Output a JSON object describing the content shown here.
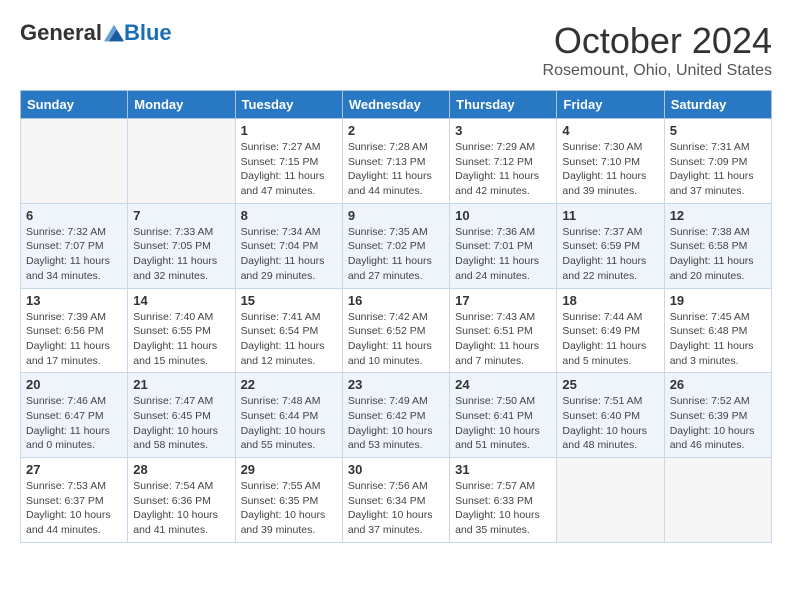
{
  "logo": {
    "general": "General",
    "blue": "Blue"
  },
  "title": "October 2024",
  "location": "Rosemount, Ohio, United States",
  "days_of_week": [
    "Sunday",
    "Monday",
    "Tuesday",
    "Wednesday",
    "Thursday",
    "Friday",
    "Saturday"
  ],
  "weeks": [
    [
      {
        "day": "",
        "info": ""
      },
      {
        "day": "",
        "info": ""
      },
      {
        "day": "1",
        "info": "Sunrise: 7:27 AM\nSunset: 7:15 PM\nDaylight: 11 hours and 47 minutes."
      },
      {
        "day": "2",
        "info": "Sunrise: 7:28 AM\nSunset: 7:13 PM\nDaylight: 11 hours and 44 minutes."
      },
      {
        "day": "3",
        "info": "Sunrise: 7:29 AM\nSunset: 7:12 PM\nDaylight: 11 hours and 42 minutes."
      },
      {
        "day": "4",
        "info": "Sunrise: 7:30 AM\nSunset: 7:10 PM\nDaylight: 11 hours and 39 minutes."
      },
      {
        "day": "5",
        "info": "Sunrise: 7:31 AM\nSunset: 7:09 PM\nDaylight: 11 hours and 37 minutes."
      }
    ],
    [
      {
        "day": "6",
        "info": "Sunrise: 7:32 AM\nSunset: 7:07 PM\nDaylight: 11 hours and 34 minutes."
      },
      {
        "day": "7",
        "info": "Sunrise: 7:33 AM\nSunset: 7:05 PM\nDaylight: 11 hours and 32 minutes."
      },
      {
        "day": "8",
        "info": "Sunrise: 7:34 AM\nSunset: 7:04 PM\nDaylight: 11 hours and 29 minutes."
      },
      {
        "day": "9",
        "info": "Sunrise: 7:35 AM\nSunset: 7:02 PM\nDaylight: 11 hours and 27 minutes."
      },
      {
        "day": "10",
        "info": "Sunrise: 7:36 AM\nSunset: 7:01 PM\nDaylight: 11 hours and 24 minutes."
      },
      {
        "day": "11",
        "info": "Sunrise: 7:37 AM\nSunset: 6:59 PM\nDaylight: 11 hours and 22 minutes."
      },
      {
        "day": "12",
        "info": "Sunrise: 7:38 AM\nSunset: 6:58 PM\nDaylight: 11 hours and 20 minutes."
      }
    ],
    [
      {
        "day": "13",
        "info": "Sunrise: 7:39 AM\nSunset: 6:56 PM\nDaylight: 11 hours and 17 minutes."
      },
      {
        "day": "14",
        "info": "Sunrise: 7:40 AM\nSunset: 6:55 PM\nDaylight: 11 hours and 15 minutes."
      },
      {
        "day": "15",
        "info": "Sunrise: 7:41 AM\nSunset: 6:54 PM\nDaylight: 11 hours and 12 minutes."
      },
      {
        "day": "16",
        "info": "Sunrise: 7:42 AM\nSunset: 6:52 PM\nDaylight: 11 hours and 10 minutes."
      },
      {
        "day": "17",
        "info": "Sunrise: 7:43 AM\nSunset: 6:51 PM\nDaylight: 11 hours and 7 minutes."
      },
      {
        "day": "18",
        "info": "Sunrise: 7:44 AM\nSunset: 6:49 PM\nDaylight: 11 hours and 5 minutes."
      },
      {
        "day": "19",
        "info": "Sunrise: 7:45 AM\nSunset: 6:48 PM\nDaylight: 11 hours and 3 minutes."
      }
    ],
    [
      {
        "day": "20",
        "info": "Sunrise: 7:46 AM\nSunset: 6:47 PM\nDaylight: 11 hours and 0 minutes."
      },
      {
        "day": "21",
        "info": "Sunrise: 7:47 AM\nSunset: 6:45 PM\nDaylight: 10 hours and 58 minutes."
      },
      {
        "day": "22",
        "info": "Sunrise: 7:48 AM\nSunset: 6:44 PM\nDaylight: 10 hours and 55 minutes."
      },
      {
        "day": "23",
        "info": "Sunrise: 7:49 AM\nSunset: 6:42 PM\nDaylight: 10 hours and 53 minutes."
      },
      {
        "day": "24",
        "info": "Sunrise: 7:50 AM\nSunset: 6:41 PM\nDaylight: 10 hours and 51 minutes."
      },
      {
        "day": "25",
        "info": "Sunrise: 7:51 AM\nSunset: 6:40 PM\nDaylight: 10 hours and 48 minutes."
      },
      {
        "day": "26",
        "info": "Sunrise: 7:52 AM\nSunset: 6:39 PM\nDaylight: 10 hours and 46 minutes."
      }
    ],
    [
      {
        "day": "27",
        "info": "Sunrise: 7:53 AM\nSunset: 6:37 PM\nDaylight: 10 hours and 44 minutes."
      },
      {
        "day": "28",
        "info": "Sunrise: 7:54 AM\nSunset: 6:36 PM\nDaylight: 10 hours and 41 minutes."
      },
      {
        "day": "29",
        "info": "Sunrise: 7:55 AM\nSunset: 6:35 PM\nDaylight: 10 hours and 39 minutes."
      },
      {
        "day": "30",
        "info": "Sunrise: 7:56 AM\nSunset: 6:34 PM\nDaylight: 10 hours and 37 minutes."
      },
      {
        "day": "31",
        "info": "Sunrise: 7:57 AM\nSunset: 6:33 PM\nDaylight: 10 hours and 35 minutes."
      },
      {
        "day": "",
        "info": ""
      },
      {
        "day": "",
        "info": ""
      }
    ]
  ]
}
